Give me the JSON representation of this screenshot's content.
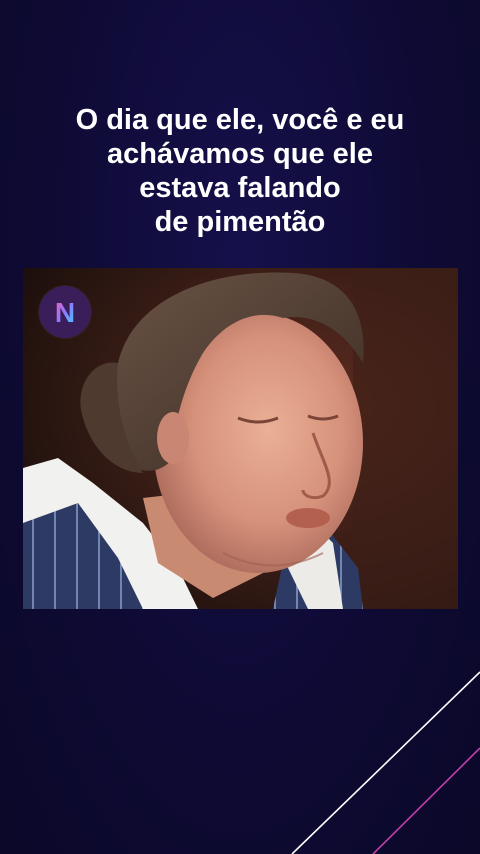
{
  "caption": {
    "lines": [
      "O dia que ele, você e eu",
      "achávamos que ele",
      "estava falando",
      "de pimentão"
    ]
  },
  "logo": {
    "icon": "n-brand-logo-icon",
    "letter": "N"
  },
  "video": {
    "content": "video-frame"
  },
  "colors": {
    "background": "#0f0b35",
    "text": "#ffffff",
    "accent_line": "#ffffff",
    "accent_line_secondary": "#c23fa8",
    "logo_bg": "#3a1e5a"
  }
}
